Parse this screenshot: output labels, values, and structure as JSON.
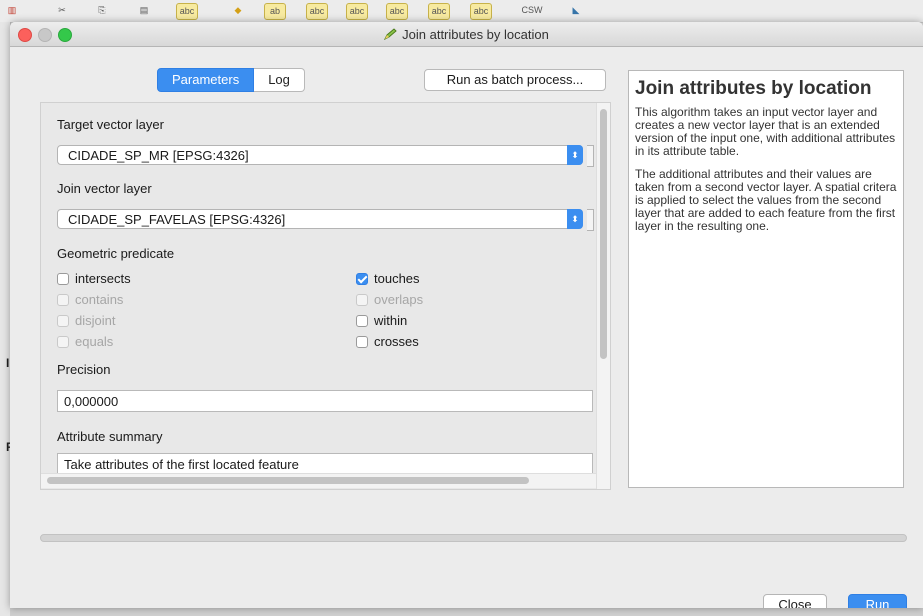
{
  "window": {
    "title": "Join attributes by location"
  },
  "background": {
    "toolbar_labels": [
      "abc",
      "abc",
      "ab",
      "abc",
      "abc",
      "abc",
      "abc",
      "CSW"
    ],
    "left_letters": [
      "IN",
      "R"
    ]
  },
  "tabs": [
    {
      "label": "Parameters",
      "active": true
    },
    {
      "label": "Log",
      "active": false
    }
  ],
  "batch_button": {
    "label": "Run as batch process..."
  },
  "params": {
    "target_label": "Target vector layer",
    "target_value": "CIDADE_SP_MR [EPSG:4326]",
    "join_label": "Join vector layer",
    "join_value": "CIDADE_SP_FAVELAS [EPSG:4326]",
    "predicate_label": "Geometric predicate",
    "predicates": [
      {
        "label": "intersects",
        "checked": false,
        "enabled": true
      },
      {
        "label": "contains",
        "checked": false,
        "enabled": false
      },
      {
        "label": "disjoint",
        "checked": false,
        "enabled": false
      },
      {
        "label": "equals",
        "checked": false,
        "enabled": false
      },
      {
        "label": "touches",
        "checked": true,
        "enabled": true
      },
      {
        "label": "overlaps",
        "checked": false,
        "enabled": false
      },
      {
        "label": "within",
        "checked": false,
        "enabled": true
      },
      {
        "label": "crosses",
        "checked": false,
        "enabled": true
      }
    ],
    "precision_label": "Precision",
    "precision_value": "0,000000",
    "summary_label": "Attribute summary",
    "summary_value": "Take attributes of the first located feature"
  },
  "help": {
    "title": "Join attributes by location",
    "paragraph1": "This algorithm takes an input vector layer and creates a new vector layer that is an extended version of the input one, with additional attributes in its attribute table.",
    "paragraph2": "The additional attributes and their values are taken from a second vector layer. A spatial critera is applied to select the values from the second layer that are added to each feature from the first layer in the resulting one."
  },
  "footer": {
    "close_label": "Close",
    "run_label": "Run"
  },
  "colors": {
    "accent": "#3b8ef0",
    "dialog_bg": "#ececec",
    "close_light": "#fc605c",
    "min_light": "#c8c8c8",
    "max_light": "#34c84a"
  },
  "icons": [
    "pencil-icon"
  ]
}
